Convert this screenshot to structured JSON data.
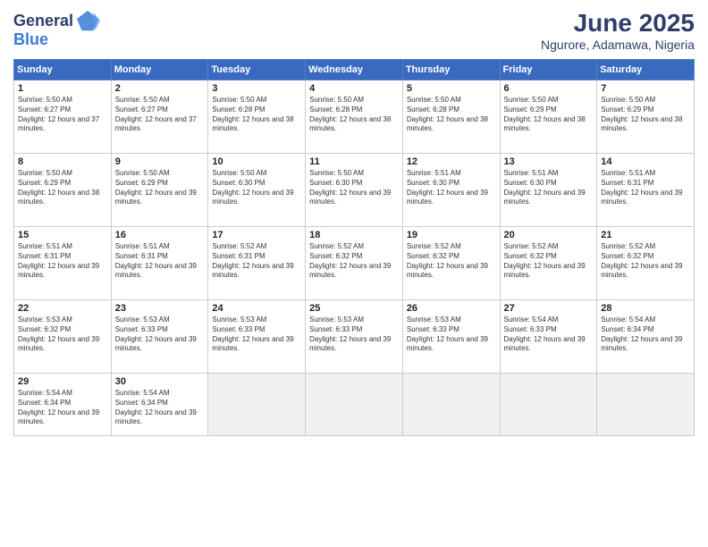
{
  "header": {
    "logo_line1": "General",
    "logo_line2": "Blue",
    "month": "June 2025",
    "location": "Ngurore, Adamawa, Nigeria"
  },
  "days_of_week": [
    "Sunday",
    "Monday",
    "Tuesday",
    "Wednesday",
    "Thursday",
    "Friday",
    "Saturday"
  ],
  "weeks": [
    [
      {
        "day": "1",
        "rise": "5:50 AM",
        "set": "6:27 PM",
        "daylight": "12 hours and 37 minutes."
      },
      {
        "day": "2",
        "rise": "5:50 AM",
        "set": "6:27 PM",
        "daylight": "12 hours and 37 minutes."
      },
      {
        "day": "3",
        "rise": "5:50 AM",
        "set": "6:28 PM",
        "daylight": "12 hours and 38 minutes."
      },
      {
        "day": "4",
        "rise": "5:50 AM",
        "set": "6:28 PM",
        "daylight": "12 hours and 38 minutes."
      },
      {
        "day": "5",
        "rise": "5:50 AM",
        "set": "6:28 PM",
        "daylight": "12 hours and 38 minutes."
      },
      {
        "day": "6",
        "rise": "5:50 AM",
        "set": "6:29 PM",
        "daylight": "12 hours and 38 minutes."
      },
      {
        "day": "7",
        "rise": "5:50 AM",
        "set": "6:29 PM",
        "daylight": "12 hours and 38 minutes."
      }
    ],
    [
      {
        "day": "8",
        "rise": "5:50 AM",
        "set": "6:29 PM",
        "daylight": "12 hours and 38 minutes."
      },
      {
        "day": "9",
        "rise": "5:50 AM",
        "set": "6:29 PM",
        "daylight": "12 hours and 39 minutes."
      },
      {
        "day": "10",
        "rise": "5:50 AM",
        "set": "6:30 PM",
        "daylight": "12 hours and 39 minutes."
      },
      {
        "day": "11",
        "rise": "5:50 AM",
        "set": "6:30 PM",
        "daylight": "12 hours and 39 minutes."
      },
      {
        "day": "12",
        "rise": "5:51 AM",
        "set": "6:30 PM",
        "daylight": "12 hours and 39 minutes."
      },
      {
        "day": "13",
        "rise": "5:51 AM",
        "set": "6:30 PM",
        "daylight": "12 hours and 39 minutes."
      },
      {
        "day": "14",
        "rise": "5:51 AM",
        "set": "6:31 PM",
        "daylight": "12 hours and 39 minutes."
      }
    ],
    [
      {
        "day": "15",
        "rise": "5:51 AM",
        "set": "6:31 PM",
        "daylight": "12 hours and 39 minutes."
      },
      {
        "day": "16",
        "rise": "5:51 AM",
        "set": "6:31 PM",
        "daylight": "12 hours and 39 minutes."
      },
      {
        "day": "17",
        "rise": "5:52 AM",
        "set": "6:31 PM",
        "daylight": "12 hours and 39 minutes."
      },
      {
        "day": "18",
        "rise": "5:52 AM",
        "set": "6:32 PM",
        "daylight": "12 hours and 39 minutes."
      },
      {
        "day": "19",
        "rise": "5:52 AM",
        "set": "6:32 PM",
        "daylight": "12 hours and 39 minutes."
      },
      {
        "day": "20",
        "rise": "5:52 AM",
        "set": "6:32 PM",
        "daylight": "12 hours and 39 minutes."
      },
      {
        "day": "21",
        "rise": "5:52 AM",
        "set": "6:32 PM",
        "daylight": "12 hours and 39 minutes."
      }
    ],
    [
      {
        "day": "22",
        "rise": "5:53 AM",
        "set": "6:32 PM",
        "daylight": "12 hours and 39 minutes."
      },
      {
        "day": "23",
        "rise": "5:53 AM",
        "set": "6:33 PM",
        "daylight": "12 hours and 39 minutes."
      },
      {
        "day": "24",
        "rise": "5:53 AM",
        "set": "6:33 PM",
        "daylight": "12 hours and 39 minutes."
      },
      {
        "day": "25",
        "rise": "5:53 AM",
        "set": "6:33 PM",
        "daylight": "12 hours and 39 minutes."
      },
      {
        "day": "26",
        "rise": "5:53 AM",
        "set": "6:33 PM",
        "daylight": "12 hours and 39 minutes."
      },
      {
        "day": "27",
        "rise": "5:54 AM",
        "set": "6:33 PM",
        "daylight": "12 hours and 39 minutes."
      },
      {
        "day": "28",
        "rise": "5:54 AM",
        "set": "6:34 PM",
        "daylight": "12 hours and 39 minutes."
      }
    ],
    [
      {
        "day": "29",
        "rise": "5:54 AM",
        "set": "6:34 PM",
        "daylight": "12 hours and 39 minutes."
      },
      {
        "day": "30",
        "rise": "5:54 AM",
        "set": "6:34 PM",
        "daylight": "12 hours and 39 minutes."
      },
      null,
      null,
      null,
      null,
      null
    ]
  ]
}
